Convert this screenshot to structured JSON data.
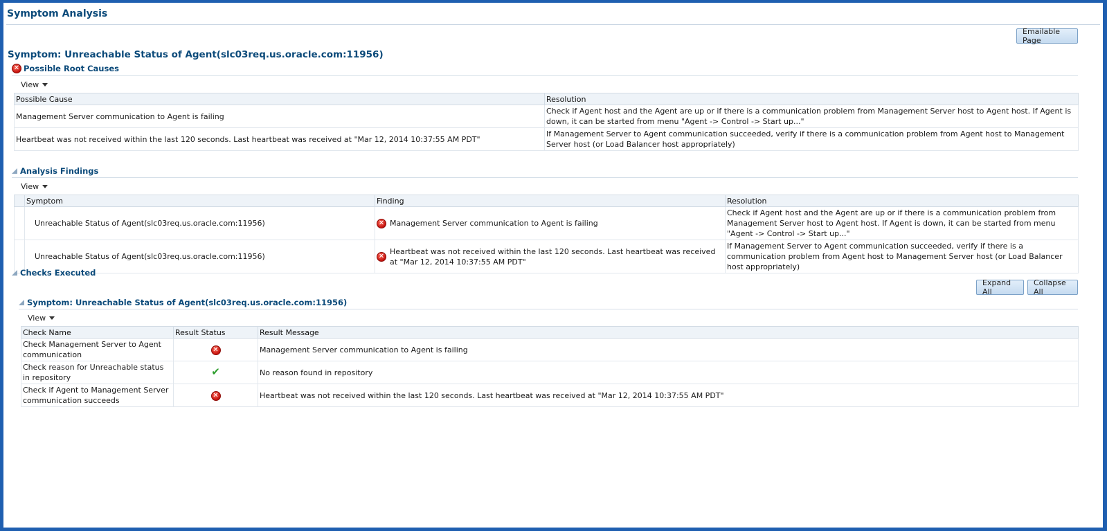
{
  "page_title": "Symptom Analysis",
  "emailable_button": "Emailable Page",
  "symptom_title": "Symptom: Unreachable Status of Agent(slc03req.us.oracle.com:11956)",
  "root_causes": {
    "heading": "Possible Root Causes",
    "view_label": "View",
    "columns": [
      "Possible Cause",
      "Resolution"
    ],
    "rows": [
      {
        "cause": "Management Server communication to Agent is failing",
        "resolution": "Check if Agent host and the Agent are up or if there is a communication problem from Management Server host to Agent host. If Agent is down, it can be started from menu \"Agent -> Control -> Start up...\""
      },
      {
        "cause": "Heartbeat was not received within the last 120 seconds. Last heartbeat was received at \"Mar 12, 2014 10:37:55 AM PDT\"",
        "resolution": "If Management Server to Agent communication succeeded, verify if there is a communication problem from Agent host to Management Server host (or Load Balancer host appropriately)"
      }
    ]
  },
  "findings": {
    "heading": "Analysis Findings",
    "view_label": "View",
    "columns": [
      "Symptom",
      "Finding",
      "Resolution"
    ],
    "rows": [
      {
        "symptom": "Unreachable Status of Agent(slc03req.us.oracle.com:11956)",
        "finding": "Management Server communication to Agent is failing",
        "resolution": "Check if Agent host and the Agent are up or if there is a communication problem from Management Server host to Agent host. If Agent is down, it can be started from menu \"Agent -> Control -> Start up...\""
      },
      {
        "symptom": "Unreachable Status of Agent(slc03req.us.oracle.com:11956)",
        "finding": "Heartbeat was not received within the last 120 seconds. Last heartbeat was received at \"Mar 12, 2014 10:37:55 AM PDT\"",
        "resolution": "If Management Server to Agent communication succeeded, verify if there is a communication problem from Agent host to Management Server host (or Load Balancer host appropriately)"
      }
    ]
  },
  "checks": {
    "heading": "Checks Executed",
    "expand_all": "Expand All",
    "collapse_all": "Collapse All",
    "sub_heading": "Symptom: Unreachable Status of Agent(slc03req.us.oracle.com:11956)",
    "view_label": "View",
    "columns": [
      "Check Name",
      "Result Status",
      "Result Message"
    ],
    "rows": [
      {
        "name": "Check Management Server to Agent communication",
        "status_icon": "error-icon",
        "message": "Management Server communication to Agent is failing"
      },
      {
        "name": "Check reason for Unreachable status in repository",
        "status_icon": "checkmark-icon",
        "message": "No reason found in repository"
      },
      {
        "name": "Check if Agent to Management Server communication succeeds",
        "status_icon": "error-icon",
        "message": "Heartbeat was not received within the last 120 seconds. Last heartbeat was received at \"Mar 12, 2014 10:37:55 AM PDT\""
      }
    ]
  },
  "colors": {
    "frame_border": "#1f5fb0",
    "heading": "#0b4a7a",
    "error": "#c4120d",
    "success": "#2e9e2e"
  }
}
